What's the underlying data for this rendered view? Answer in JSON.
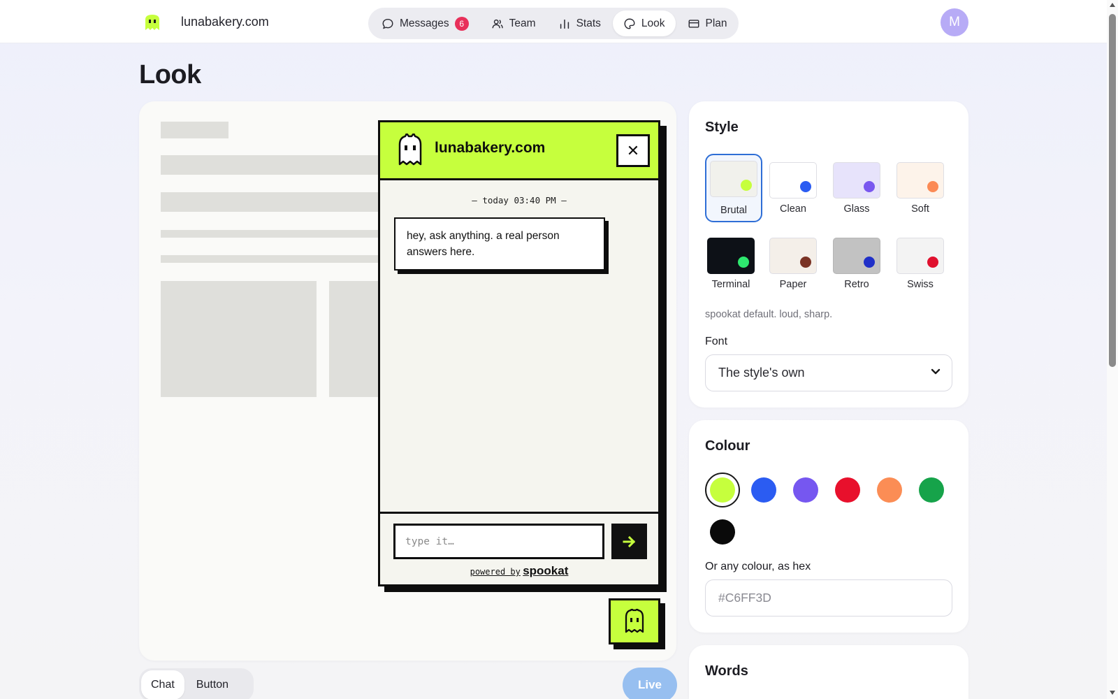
{
  "header": {
    "site_name": "lunabakery.com",
    "nav": [
      {
        "label": "Messages",
        "icon": "chat-bubble-icon",
        "badge": "6",
        "active": false
      },
      {
        "label": "Team",
        "icon": "users-icon",
        "active": false
      },
      {
        "label": "Stats",
        "icon": "bar-chart-icon",
        "active": false
      },
      {
        "label": "Look",
        "icon": "palette-icon",
        "active": true
      },
      {
        "label": "Plan",
        "icon": "card-icon",
        "active": false
      }
    ],
    "avatar_initial": "M"
  },
  "page": {
    "title": "Look"
  },
  "widget": {
    "title": "lunabakery.com",
    "close_glyph": "✕",
    "timestamp": "— today 03:40 PM —",
    "greeting": "hey, ask anything. a real person answers here.",
    "input_placeholder": "type it…",
    "powered_by": "powered by",
    "brand": "spookat",
    "accent_color": "#C6FF3D"
  },
  "preview_mode": {
    "options": [
      "Chat",
      "Button"
    ],
    "selected": "Chat",
    "live_label": "Live"
  },
  "style_panel": {
    "title": "Style",
    "styles": [
      {
        "label": "Brutal",
        "swatch": "#f1f1ec",
        "dot": "#c6ff3d",
        "selected": true
      },
      {
        "label": "Clean",
        "swatch": "#ffffff",
        "dot": "#2b5cf2",
        "selected": false
      },
      {
        "label": "Glass",
        "swatch": "#e7e3fb",
        "dot": "#7957ef",
        "selected": false
      },
      {
        "label": "Soft",
        "swatch": "#fdf3ea",
        "dot": "#fb8a55",
        "selected": false
      },
      {
        "label": "Terminal",
        "swatch": "#0d1117",
        "dot": "#2ee86f",
        "selected": false
      },
      {
        "label": "Paper",
        "swatch": "#f4efe9",
        "dot": "#7a3325",
        "selected": false
      },
      {
        "label": "Retro",
        "swatch": "#c2c2c2",
        "dot": "#2030c8",
        "selected": false
      },
      {
        "label": "Swiss",
        "swatch": "#f3f3f3",
        "dot": "#e0102e",
        "selected": false
      }
    ],
    "description": "spookat default. loud, sharp.",
    "font_label": "Font",
    "font_value": "The style's own"
  },
  "colour_panel": {
    "title": "Colour",
    "colours": [
      "#c6ff3d",
      "#2b5cf2",
      "#7657f0",
      "#e8102c",
      "#fb8d55",
      "#16a34a",
      "#0a0a0a"
    ],
    "selected_colour": "#c6ff3d",
    "hex_label": "Or any colour, as hex",
    "hex_placeholder": "#C6FF3D"
  },
  "words_panel": {
    "title": "Words"
  }
}
